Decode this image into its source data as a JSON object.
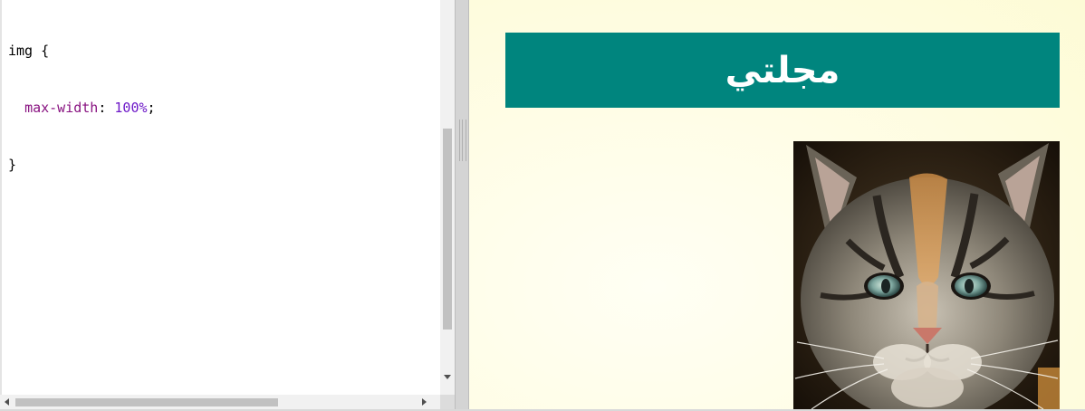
{
  "editor": {
    "lines": [
      {
        "selector": "img {"
      },
      {
        "property": "max-width",
        "colon": ": ",
        "value": "100%",
        "semicolon": ";"
      },
      {
        "close": "}"
      }
    ]
  },
  "preview": {
    "heading": "مجلتي",
    "image_icon": "kitten-photo",
    "header_color": "#00857e"
  }
}
